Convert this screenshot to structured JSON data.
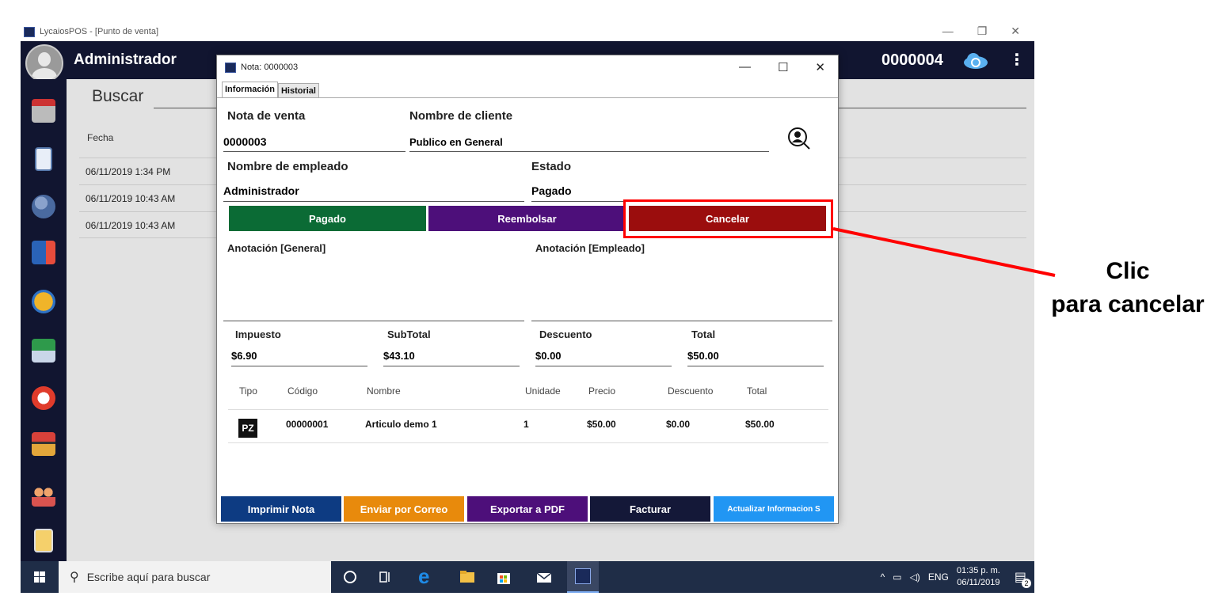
{
  "app": {
    "window_title": "LycaiosPOS - [Punto de venta]",
    "user": "Administrador",
    "current_note": "0000004"
  },
  "main": {
    "search_label": "Buscar",
    "column_fecha": "Fecha",
    "rows": [
      "06/11/2019 1:34 PM",
      "06/11/2019 10:43 AM",
      "06/11/2019 10:43 AM"
    ]
  },
  "modal": {
    "title": "Nota: 0000003",
    "tabs": [
      "Información",
      "Historial"
    ],
    "nota_label": "Nota de venta",
    "nota_value": "0000003",
    "cliente_label": "Nombre de cliente",
    "cliente_value": "Publico en General",
    "empleado_label": "Nombre de empleado",
    "empleado_value": "Administrador",
    "estado_label": "Estado",
    "estado_value": "Pagado",
    "btn_pagado": "Pagado",
    "btn_reembolsar": "Reembolsar",
    "btn_cancelar": "Cancelar",
    "anot_general": "Anotación [General]",
    "anot_empleado": "Anotación [Empleado]",
    "totals": {
      "impuesto_label": "Impuesto",
      "impuesto": "$6.90",
      "subtotal_label": "SubTotal",
      "subtotal": "$43.10",
      "descuento_label": "Descuento",
      "descuento": "$0.00",
      "total_label": "Total",
      "total": "$50.00"
    },
    "table": {
      "headers": [
        "Tipo",
        "Código",
        "Nombre",
        "Unidade",
        "Precio",
        "Descuento",
        "Total"
      ],
      "row": {
        "tipo": "PZ",
        "codigo": "00000001",
        "nombre": "Articulo demo 1",
        "unidad": "1",
        "precio": "$50.00",
        "descuento": "$0.00",
        "total": "$50.00"
      }
    },
    "footer_buttons": [
      "Imprimir Nota",
      "Enviar por Correo",
      "Exportar a PDF",
      "Facturar",
      "Actualizar Informacion S"
    ]
  },
  "callout": {
    "line1": "Clic",
    "line2": "para cancelar"
  },
  "taskbar": {
    "search_placeholder": "Escribe aquí para buscar",
    "lang": "ENG",
    "time": "01:35 p. m.",
    "date": "06/11/2019",
    "notifications": "2"
  },
  "colors": {
    "pagado": "#0b6b35",
    "reembolsar": "#4d0f7a",
    "cancelar": "#9b0d0d",
    "imprimir": "#0d3b82",
    "correo": "#e88a0c",
    "pdf": "#4d0f7a",
    "facturar": "#141838",
    "actualizar": "#2196f3"
  }
}
